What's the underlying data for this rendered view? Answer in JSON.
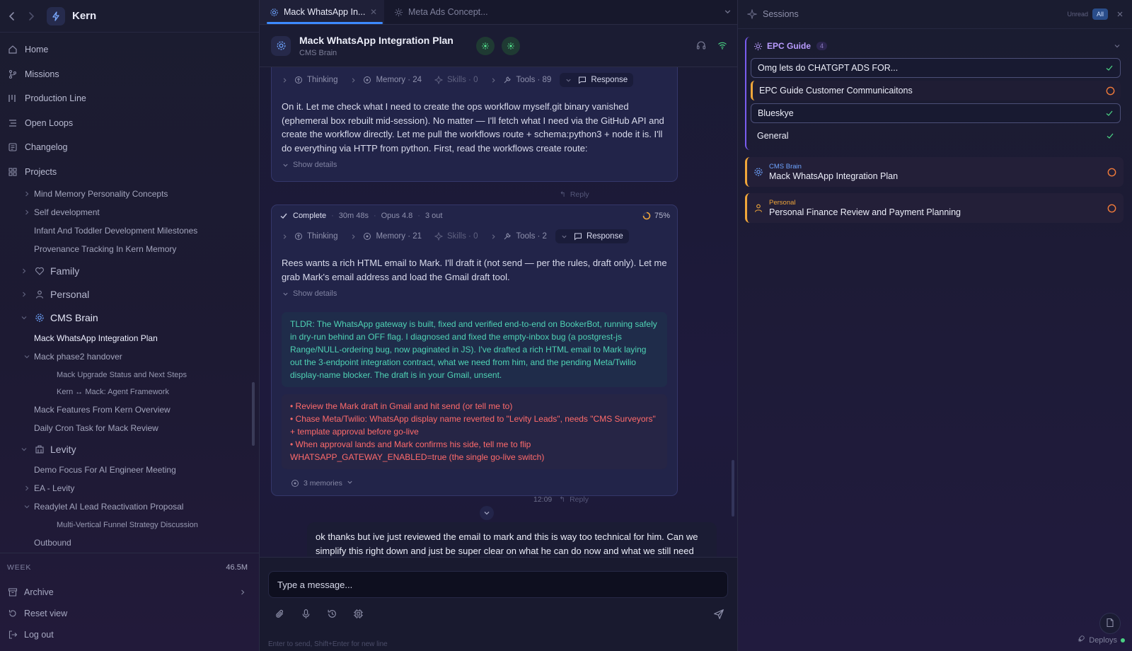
{
  "app": {
    "title": "Kern"
  },
  "sidebar": {
    "nav": [
      {
        "label": "Home",
        "icon": "home-icon"
      },
      {
        "label": "Missions",
        "icon": "branch-icon"
      },
      {
        "label": "Production Line",
        "icon": "columns-icon"
      },
      {
        "label": "Open Loops",
        "icon": "list-icon"
      },
      {
        "label": "Changelog",
        "icon": "changelog-icon"
      },
      {
        "label": "Projects",
        "icon": "grid-icon"
      }
    ],
    "tree": {
      "mind_memory": "Mind Memory Personality Concepts",
      "self_dev": "Self development",
      "infant": "Infant And Toddler Development Milestones",
      "provenance": "Provenance Tracking In Kern Memory",
      "family": "Family",
      "personal": "Personal",
      "cms_brain": "CMS Brain",
      "mack_plan": "Mack WhatsApp Integration Plan",
      "mack_phase2": "Mack phase2 handover",
      "mack_upgrade": "Mack Upgrade Status and Next Steps",
      "kern_mack": "Kern ↔ Mack: Agent Framework",
      "mack_features": "Mack Features From Kern Overview",
      "daily_cron": "Daily Cron Task for Mack Review",
      "levity": "Levity",
      "demo_focus": "Demo Focus For AI Engineer Meeting",
      "ea_levity": "EA - Levity",
      "readylet": "Readylet AI Lead Reactivation Proposal",
      "multi_vertical": "Multi-Vertical Funnel Strategy Discussion",
      "outbound": "Outbound"
    },
    "week_label": "WEEK",
    "week_value": "46.5M",
    "archive": "Archive",
    "reset_view": "Reset view",
    "log_out": "Log out"
  },
  "tabs": [
    {
      "label": "Mack WhatsApp In...",
      "active": true
    },
    {
      "label": "Meta Ads Concept...",
      "active": false
    }
  ],
  "chat": {
    "title": "Mack WhatsApp Integration Plan",
    "subtitle": "CMS Brain",
    "msg1": {
      "thinking": "Thinking",
      "memory": "Memory · 24",
      "skills": "Skills · 0",
      "tools": "Tools · 89",
      "response": "Response",
      "text": "On it. Let me check what I need to create the ops workflow myself.git binary vanished (ephemeral box rebuilt mid-session). No matter — I'll fetch what I need via the GitHub API and create the workflow directly. Let me pull the workflows route + schema:python3 + node it is. I'll do everything via HTTP from python. First, read the workflows create route:",
      "show_details": "Show details",
      "reply": "Reply"
    },
    "msg2": {
      "status": "Complete",
      "duration": "30m 48s",
      "model": "Opus 4.8",
      "out": "3 out",
      "progress": "75%",
      "thinking": "Thinking",
      "memory": "Memory · 21",
      "skills": "Skills · 0",
      "tools": "Tools · 2",
      "response": "Response",
      "text": "Rees wants a rich HTML email to Mark. I'll draft it (not send — per the rules, draft only). Let me grab Mark's email address and load the Gmail draft tool.",
      "show_details": "Show details",
      "tldr": "TLDR: The WhatsApp gateway is built, fixed and verified end-to-end on BookerBot, running safely in dry-run behind an OFF flag. I diagnosed and fixed the empty-inbox bug (a postgrest-js Range/NULL-ordering bug, now paginated in JS). I've drafted a rich HTML email to Mark laying out the 3-endpoint integration contract, what we need from him, and the pending Meta/Twilio display-name blocker. The draft is in your Gmail, unsent.",
      "todos": [
        "• Review the Mark draft in Gmail and hit send (or tell me to)",
        "• Chase Meta/Twilio: WhatsApp display name reverted to \"Levity Leads\", needs \"CMS Surveyors\" + template approval before go-live",
        "• When approval lands and Mark confirms his side, tell me to flip WHATSAPP_GATEWAY_ENABLED=true (the single go-live switch)"
      ],
      "memories": "3 memories",
      "time": "12:09",
      "reply": "Reply"
    },
    "user_msg": "ok thanks but ive just reviewed the email to mark and this is way too technical for him. Can we simplify this right down and just be super clear on what he can do now and what we still need",
    "input_placeholder": "Type a message...",
    "hint": "Enter to send, Shift+Enter for new line"
  },
  "sessions": {
    "title": "Sessions",
    "filter_unread": "Unread",
    "filter_all": "All",
    "group": {
      "name": "EPC Guide",
      "count": "4",
      "items": [
        {
          "label": "Omg lets do CHATGPT ADS FOR...",
          "status": "done"
        },
        {
          "label": "EPC Guide Customer Communicaitons",
          "status": "pending"
        },
        {
          "label": "Blueskye",
          "status": "done"
        },
        {
          "label": "General",
          "status": "done"
        }
      ]
    },
    "cards": [
      {
        "project": "CMS Brain",
        "name": "Mack WhatsApp Integration Plan",
        "color": "#6ea4ff"
      },
      {
        "project": "Personal",
        "name": "Personal Finance Review and Payment Planning",
        "color": "#f0a63a"
      }
    ],
    "deploys": "Deploys"
  }
}
